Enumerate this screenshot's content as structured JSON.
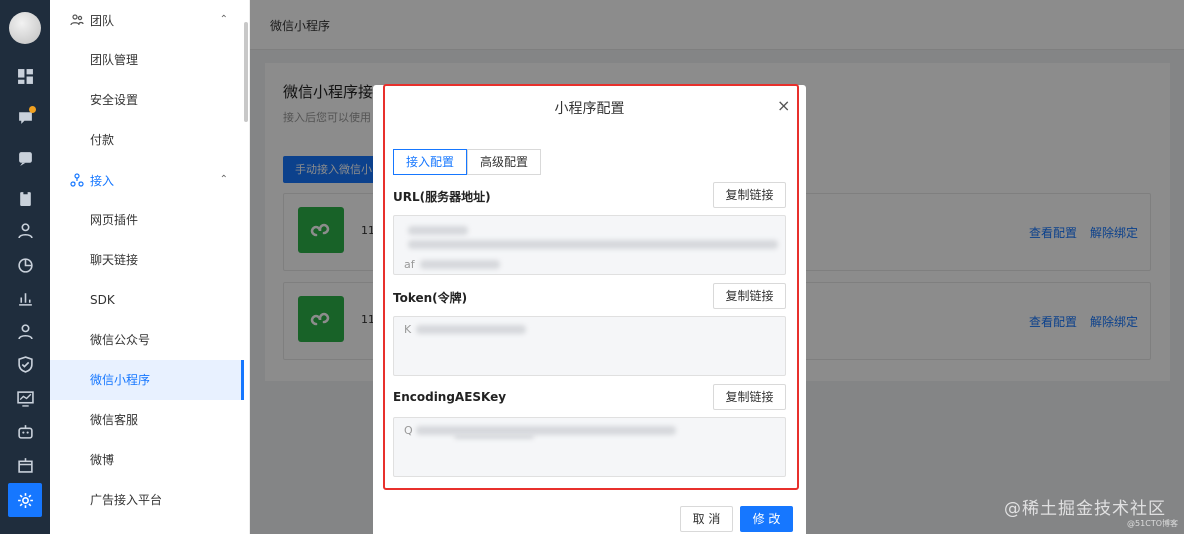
{
  "rail": {
    "icons": [
      "avatar",
      "dashboard-icon",
      "chat-icon",
      "message-icon",
      "clipboard-icon",
      "user-icon",
      "chart-icon",
      "bar-chart-icon",
      "users-icon",
      "shield-icon",
      "monitor-icon",
      "robot-icon",
      "box-icon",
      "settings-icon"
    ],
    "active": "settings-icon"
  },
  "sidebar": {
    "group_team": "团队",
    "team_items": [
      "团队管理",
      "安全设置",
      "付款"
    ],
    "group_access": "接入",
    "access_items": [
      "网页插件",
      "聊天链接",
      "SDK",
      "微信公众号",
      "微信小程序",
      "微信客服",
      "微博",
      "广告接入平台"
    ],
    "active_item": "微信小程序"
  },
  "topbar": {
    "title": "微信小程序"
  },
  "page": {
    "heading": "微信小程序接",
    "subtitle": "接入后您可以使用",
    "manual_button": "手动接入微信小",
    "accounts": [
      {
        "name": "11",
        "view_config": "查看配置",
        "unbind": "解除绑定"
      },
      {
        "name": "11",
        "view_config": "查看配置",
        "unbind": "解除绑定"
      }
    ]
  },
  "modal": {
    "title": "小程序配置",
    "close": "×",
    "tabs": [
      "接入配置",
      "高级配置"
    ],
    "active_tab": "接入配置",
    "fields": [
      {
        "label": "URL(服务器地址)",
        "copy": "复制链接",
        "visible_prefix": "af"
      },
      {
        "label": "Token(令牌)",
        "copy": "复制链接",
        "visible_prefix": "K"
      },
      {
        "label": "EncodingAESKey",
        "copy": "复制链接",
        "visible_prefix": "Q"
      }
    ],
    "cancel": "取 消",
    "submit": "修 改"
  },
  "watermark": {
    "main": "@稀土掘金技术社区",
    "small": "@51CTO博客"
  },
  "colors": {
    "accent": "#1677ff",
    "rail": "#1f2d3d",
    "highlight_box": "#e8302c",
    "miniprogram_green": "#2cb34a"
  }
}
